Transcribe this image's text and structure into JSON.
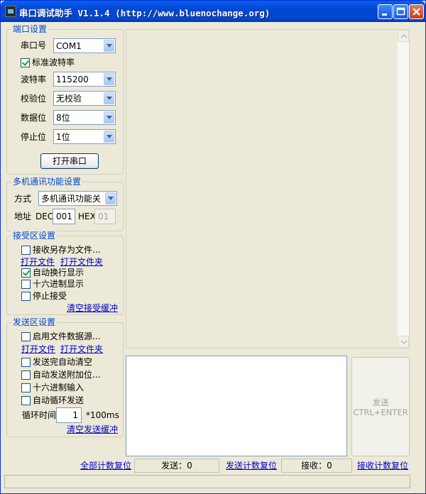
{
  "window": {
    "title": "串口调试助手 V1.1.4 (http://www.bluenochange.org)"
  },
  "port_settings": {
    "group_title": "端口设置",
    "port_label": "串口号",
    "port_value": "COM1",
    "std_baud_label": "标准波特率",
    "baud_label": "波特率",
    "baud_value": "115200",
    "parity_label": "校验位",
    "parity_value": "无校验",
    "databits_label": "数据位",
    "databits_value": "8位",
    "stopbits_label": "停止位",
    "stopbits_value": "1位",
    "open_button": "打开串口"
  },
  "multi_settings": {
    "group_title": "多机通讯功能设置",
    "mode_label": "方式",
    "mode_value": "多机通讯功能关",
    "addr_label": "地址",
    "dec_label": "DEC",
    "dec_value": "001",
    "hex_label": "HEX",
    "hex_value": "01"
  },
  "recv_settings": {
    "group_title": "接受区设置",
    "save_to_file": "接收另存为文件...",
    "open_file": "打开文件",
    "open_folder": "打开文件夹",
    "auto_wrap": "自动换行显示",
    "hex_display": "十六进制显示",
    "stop_receive": "停止接受",
    "clear_recv": "清空接受缓冲"
  },
  "send_settings": {
    "group_title": "发送区设置",
    "file_source": "启用文件数据源...",
    "open_file": "打开文件",
    "open_folder": "打开文件夹",
    "auto_clear": "发送完自动清空",
    "auto_append": "自动发送附加位...",
    "hex_input": "十六进制输入",
    "auto_loop": "自动循环发送",
    "cycle_label": "循环时间",
    "cycle_value": "1",
    "cycle_unit": "*100ms",
    "clear_send": "清空发送缓冲"
  },
  "send_button": {
    "line1": "发送",
    "line2": "CTRL+ENTER"
  },
  "counters": {
    "reset_all": "全部计数复位",
    "sent": "发送：0",
    "reset_sent": "发送计数复位",
    "received": "接收：0",
    "reset_recv": "接收计数复位"
  },
  "checkbox_state": {
    "std_baud": true,
    "save_to_file": false,
    "auto_wrap": true,
    "hex_display": false,
    "stop_receive": false,
    "file_source": false,
    "auto_clear": false,
    "auto_append": false,
    "hex_input": false,
    "auto_loop": false
  },
  "colors": {
    "title_bar": "#0054e3",
    "group_title": "#0046d5",
    "link": "#0000cc",
    "window_bg": "#ece9d8"
  },
  "icons": [
    "minimize-icon",
    "maximize-icon",
    "close-icon",
    "checkmark-icon",
    "dropdown-arrow-icon",
    "scroll-up-icon",
    "scroll-down-icon"
  ]
}
